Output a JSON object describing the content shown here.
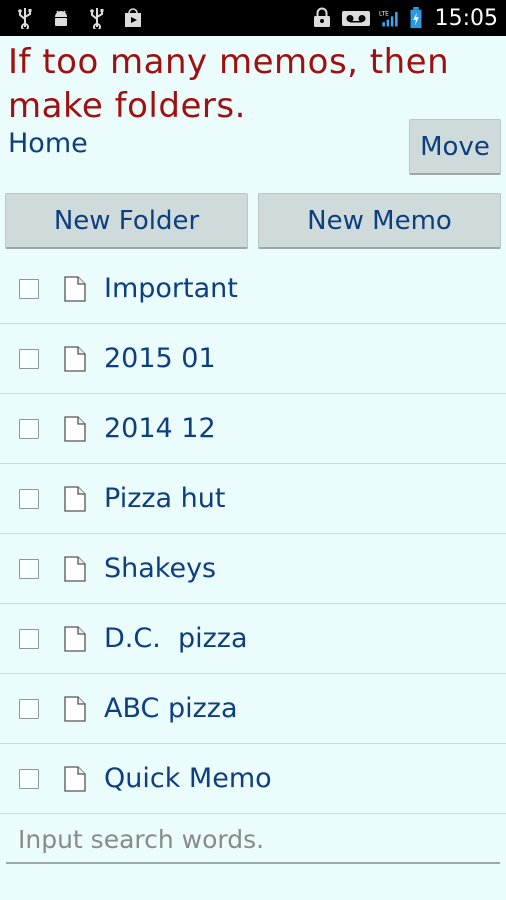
{
  "status_bar": {
    "time": "15:05",
    "icons_left": [
      "usb-icon",
      "android-debug-icon",
      "usb-icon",
      "play-store-icon"
    ],
    "icons_right": [
      "lock-icon",
      "voicemail-icon",
      "lte-signal-icon",
      "battery-charging-icon"
    ],
    "network_label": "LTE"
  },
  "header": {
    "tagline": "If too many memos, then make folders.",
    "breadcrumb": "Home",
    "move_label": "Move"
  },
  "toolbar": {
    "new_folder_label": "New Folder",
    "new_memo_label": "New Memo"
  },
  "memos": [
    {
      "title": "Important"
    },
    {
      "title": "2015 01"
    },
    {
      "title": "2014 12"
    },
    {
      "title": "Pizza hut"
    },
    {
      "title": "Shakeys"
    },
    {
      "title": "D.C.  pizza"
    },
    {
      "title": "ABC pizza"
    },
    {
      "title": "Quick Memo"
    }
  ],
  "search": {
    "placeholder": "Input search words.",
    "value": ""
  },
  "colors": {
    "background": "#eafcfc",
    "tagline": "#a01010",
    "text": "#0d3f7f",
    "button": "#cfdbdb",
    "battery": "#2b9be0"
  }
}
